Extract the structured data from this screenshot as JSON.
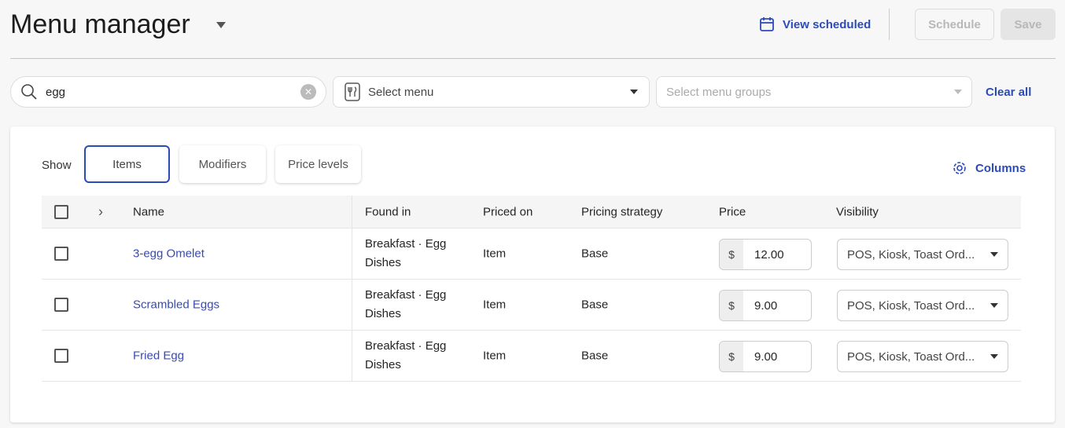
{
  "header": {
    "title": "Menu manager",
    "view_scheduled": "View scheduled",
    "schedule": "Schedule",
    "save": "Save"
  },
  "filters": {
    "search_value": "egg",
    "menu_placeholder": "Select menu",
    "groups_placeholder": "Select menu groups",
    "clear_all": "Clear all"
  },
  "show": {
    "label": "Show",
    "tabs": [
      {
        "label": "Items",
        "active": true
      },
      {
        "label": "Modifiers"
      },
      {
        "label": "Price levels"
      }
    ],
    "columns": "Columns"
  },
  "table": {
    "headers": [
      "Name",
      "Found in",
      "Priced on",
      "Pricing strategy",
      "Price",
      "Visibility"
    ],
    "rows": [
      {
        "name": "3-egg Omelet",
        "found1": "Breakfast · Egg",
        "found2": "Dishes",
        "priced_on": "Item",
        "strategy": "Base",
        "currency": "$",
        "price": "12.00",
        "visibility": "POS, Kiosk, Toast Ord..."
      },
      {
        "name": "Scrambled Eggs",
        "found1": "Breakfast · Egg",
        "found2": "Dishes",
        "priced_on": "Item",
        "strategy": "Base",
        "currency": "$",
        "price": "9.00",
        "visibility": "POS, Kiosk, Toast Ord..."
      },
      {
        "name": "Fried Egg",
        "found1": "Breakfast · Egg",
        "found2": "Dishes",
        "priced_on": "Item",
        "strategy": "Base",
        "currency": "$",
        "price": "9.00",
        "visibility": "POS, Kiosk, Toast Ord..."
      }
    ]
  },
  "colors": {
    "accent": "#2b4bb9",
    "link": "#3a4bb0"
  }
}
